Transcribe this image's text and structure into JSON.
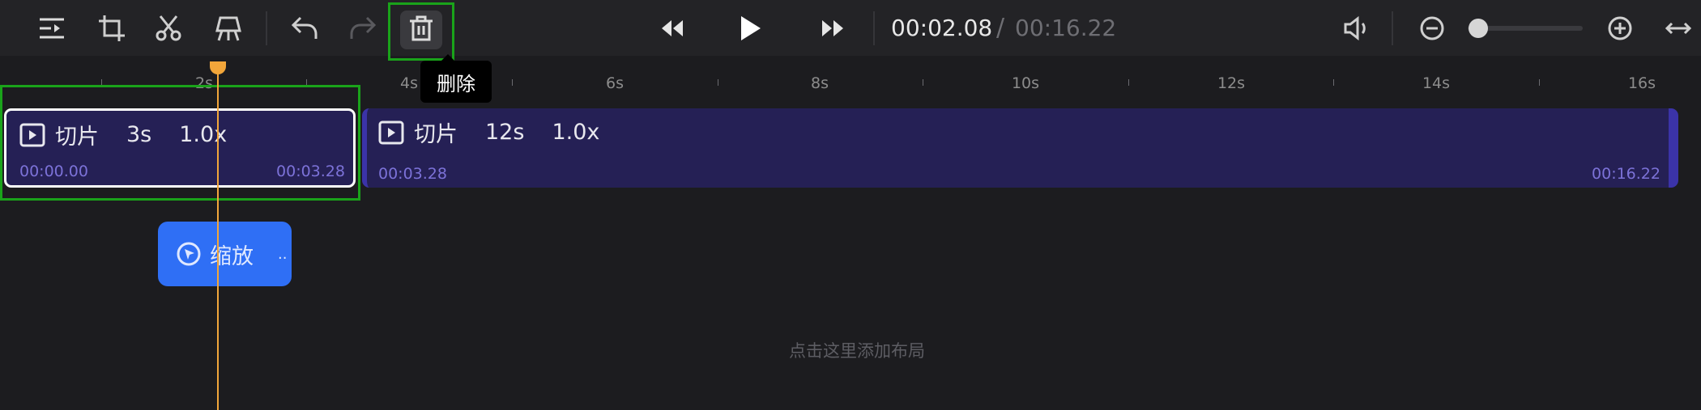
{
  "toolbar": {
    "current_time": "00:02.08",
    "divider": "/",
    "total_time": "00:16.22",
    "zoom_level": 0
  },
  "tooltip": {
    "delete_label": "删除"
  },
  "ruler": {
    "labels": [
      "2s",
      "4s",
      "6s",
      "8s",
      "10s",
      "12s",
      "14s",
      "16s"
    ]
  },
  "clips": [
    {
      "name": "切片",
      "duration": "3s",
      "speed": "1.0x",
      "start": "00:00.00",
      "end": "00:03.28"
    },
    {
      "name": "切片",
      "duration": "12s",
      "speed": "1.0x",
      "start": "00:03.28",
      "end": "00:16.22"
    }
  ],
  "zoom_effect": {
    "label": "缩放",
    "ellipsis": ".."
  },
  "layout_hint": "点击这里添加布局",
  "colors": {
    "accent": "#2f6ff5",
    "clip": "#252055",
    "playhead": "#f2a63a",
    "highlight": "#1aa31a"
  }
}
